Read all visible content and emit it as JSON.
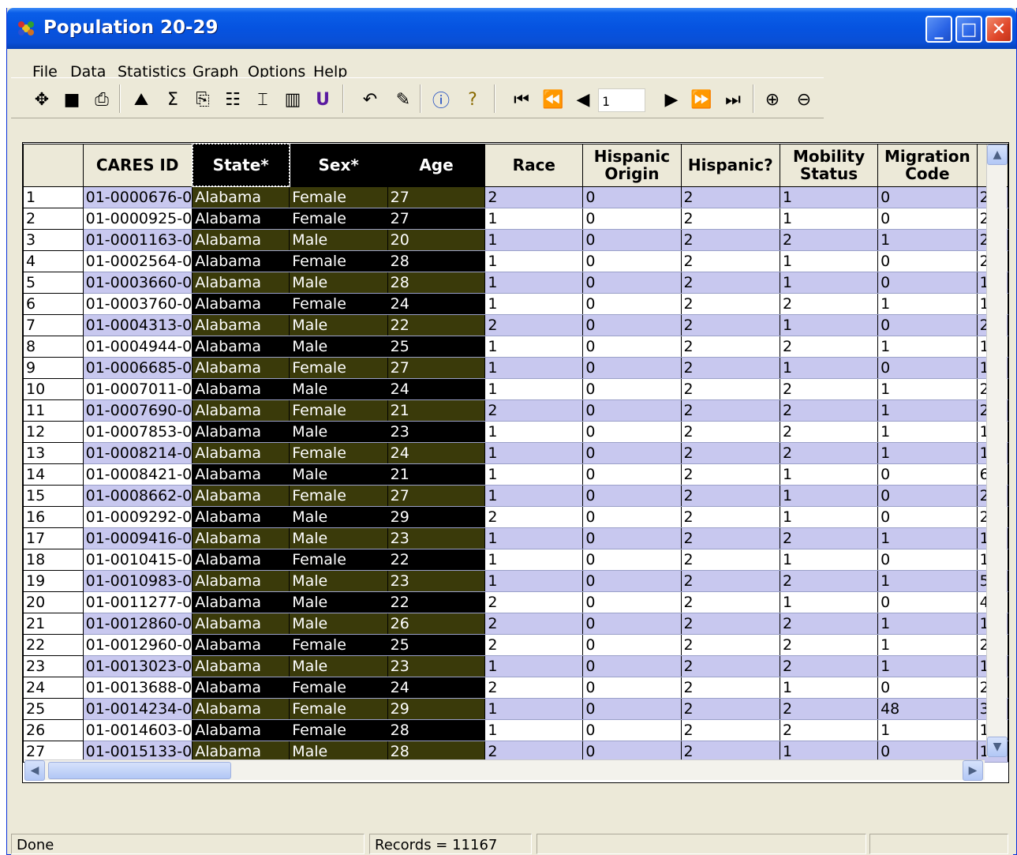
{
  "window": {
    "title": "Population 20-29"
  },
  "menu": [
    "File",
    "Data",
    "Statistics",
    "Graph",
    "Options",
    "Help"
  ],
  "toolbar": {
    "record_number": "1"
  },
  "columns": [
    "",
    "CARES ID",
    "State*",
    "Sex*",
    "Age",
    "Race",
    "Hispanic Origin",
    "Hispanic?",
    "Mobility Status",
    "Migration Code",
    ""
  ],
  "rows": [
    [
      "1",
      "01-0000676-0",
      "Alabama",
      "Female",
      "27",
      "2",
      "0",
      "2",
      "1",
      "0",
      "2"
    ],
    [
      "2",
      "01-0000925-0",
      "Alabama",
      "Female",
      "27",
      "1",
      "0",
      "2",
      "1",
      "0",
      "2"
    ],
    [
      "3",
      "01-0001163-0",
      "Alabama",
      "Male",
      "20",
      "1",
      "0",
      "2",
      "2",
      "1",
      "2"
    ],
    [
      "4",
      "01-0002564-0",
      "Alabama",
      "Female",
      "28",
      "1",
      "0",
      "2",
      "1",
      "0",
      "2"
    ],
    [
      "5",
      "01-0003660-0",
      "Alabama",
      "Male",
      "28",
      "1",
      "0",
      "2",
      "1",
      "0",
      "1"
    ],
    [
      "6",
      "01-0003760-0",
      "Alabama",
      "Female",
      "24",
      "1",
      "0",
      "2",
      "2",
      "1",
      "1"
    ],
    [
      "7",
      "01-0004313-0",
      "Alabama",
      "Male",
      "22",
      "2",
      "0",
      "2",
      "1",
      "0",
      "2"
    ],
    [
      "8",
      "01-0004944-0",
      "Alabama",
      "Male",
      "25",
      "1",
      "0",
      "2",
      "2",
      "1",
      "1"
    ],
    [
      "9",
      "01-0006685-0",
      "Alabama",
      "Female",
      "27",
      "1",
      "0",
      "2",
      "1",
      "0",
      "1"
    ],
    [
      "10",
      "01-0007011-0",
      "Alabama",
      "Male",
      "24",
      "1",
      "0",
      "2",
      "2",
      "1",
      "2"
    ],
    [
      "11",
      "01-0007690-0",
      "Alabama",
      "Female",
      "21",
      "2",
      "0",
      "2",
      "2",
      "1",
      "2"
    ],
    [
      "12",
      "01-0007853-0",
      "Alabama",
      "Male",
      "23",
      "1",
      "0",
      "2",
      "2",
      "1",
      "1"
    ],
    [
      "13",
      "01-0008214-0",
      "Alabama",
      "Female",
      "24",
      "1",
      "0",
      "2",
      "2",
      "1",
      "1"
    ],
    [
      "14",
      "01-0008421-0",
      "Alabama",
      "Male",
      "21",
      "1",
      "0",
      "2",
      "1",
      "0",
      "6"
    ],
    [
      "15",
      "01-0008662-0",
      "Alabama",
      "Female",
      "27",
      "1",
      "0",
      "2",
      "1",
      "0",
      "2"
    ],
    [
      "16",
      "01-0009292-0",
      "Alabama",
      "Male",
      "29",
      "2",
      "0",
      "2",
      "1",
      "0",
      "2"
    ],
    [
      "17",
      "01-0009416-0",
      "Alabama",
      "Male",
      "23",
      "1",
      "0",
      "2",
      "2",
      "1",
      "1"
    ],
    [
      "18",
      "01-0010415-0",
      "Alabama",
      "Female",
      "22",
      "1",
      "0",
      "2",
      "1",
      "0",
      "1"
    ],
    [
      "19",
      "01-0010983-0",
      "Alabama",
      "Male",
      "23",
      "1",
      "0",
      "2",
      "2",
      "1",
      "5"
    ],
    [
      "20",
      "01-0011277-0",
      "Alabama",
      "Male",
      "22",
      "2",
      "0",
      "2",
      "1",
      "0",
      "4"
    ],
    [
      "21",
      "01-0012860-0",
      "Alabama",
      "Male",
      "26",
      "2",
      "0",
      "2",
      "2",
      "1",
      "1"
    ],
    [
      "22",
      "01-0012960-0",
      "Alabama",
      "Female",
      "25",
      "2",
      "0",
      "2",
      "2",
      "1",
      "2"
    ],
    [
      "23",
      "01-0013023-0",
      "Alabama",
      "Male",
      "23",
      "1",
      "0",
      "2",
      "2",
      "1",
      "1"
    ],
    [
      "24",
      "01-0013688-0",
      "Alabama",
      "Female",
      "24",
      "2",
      "0",
      "2",
      "1",
      "0",
      "2"
    ],
    [
      "25",
      "01-0014234-0",
      "Alabama",
      "Female",
      "29",
      "1",
      "0",
      "2",
      "2",
      "48",
      "3"
    ],
    [
      "26",
      "01-0014603-0",
      "Alabama",
      "Female",
      "28",
      "1",
      "0",
      "2",
      "2",
      "1",
      "1"
    ],
    [
      "27",
      "01-0015133-0",
      "Alabama",
      "Male",
      "28",
      "2",
      "0",
      "2",
      "1",
      "0",
      "1"
    ]
  ],
  "status": {
    "left": "Done",
    "records": "Records = 11167"
  }
}
